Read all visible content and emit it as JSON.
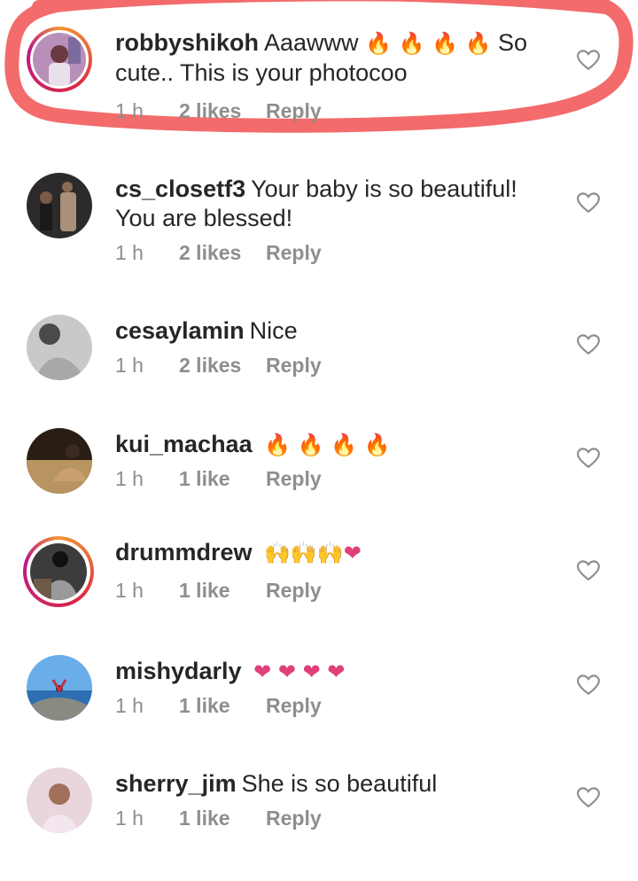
{
  "comments": [
    {
      "username": "robbyshikoh",
      "text": "Aaawww",
      "after_emoji": "So cute.. This is your photocoo",
      "time": "1 h",
      "likes": "2 likes",
      "reply": "Reply"
    },
    {
      "username": "cs_closetf3",
      "text": "Your baby is so beautiful! You are blessed!",
      "time": "1 h",
      "likes": "2 likes",
      "reply": "Reply"
    },
    {
      "username": "cesaylamin",
      "text": "Nice",
      "time": "1 h",
      "likes": "2 likes",
      "reply": "Reply"
    },
    {
      "username": "kui_machaa",
      "text": "",
      "time": "1 h",
      "likes": "1 like",
      "reply": "Reply"
    },
    {
      "username": "drummdrew",
      "text": "",
      "time": "1 h",
      "likes": "1 like",
      "reply": "Reply"
    },
    {
      "username": "mishydarly",
      "text": "",
      "time": "1 h",
      "likes": "1 like",
      "reply": "Reply"
    },
    {
      "username": "sherry_jim",
      "text": "She is so beautiful",
      "time": "1 h",
      "likes": "1 like",
      "reply": "Reply"
    }
  ],
  "icons": {
    "like": "heart-outline-icon",
    "fire": "fire-emoji-icon",
    "heart": "red-heart-emoji-icon",
    "clap": "raising-hands-emoji-icon"
  },
  "colors": {
    "highlight": "#f36b6b",
    "meta_text": "#8e8e8e",
    "username": "#262626"
  }
}
